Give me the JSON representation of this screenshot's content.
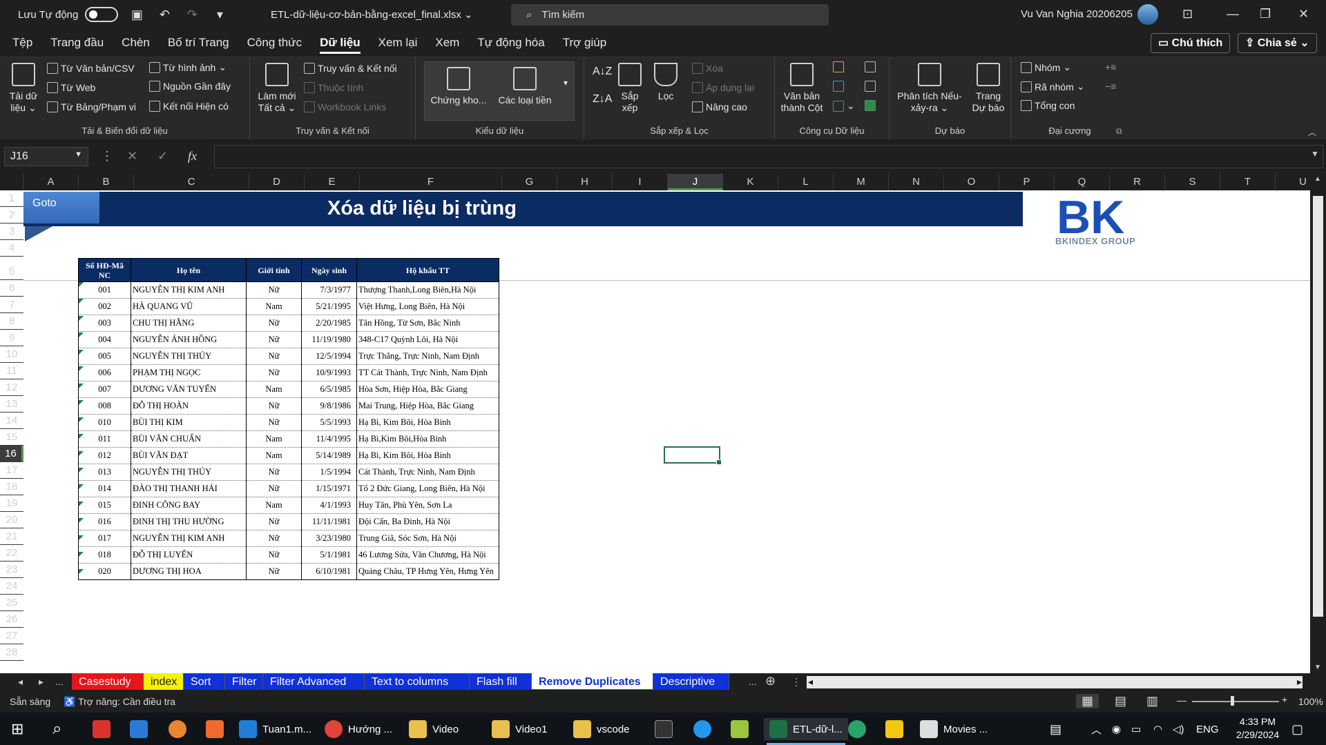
{
  "titlebar": {
    "autosave_label": "Lưu Tự động",
    "filename": "ETL-dữ-liệu-cơ-bản-bằng-excel_final.xlsx",
    "search_placeholder": "Tìm kiếm",
    "user": "Vu Van Nghia 20206205"
  },
  "menu": {
    "tabs": [
      "Tệp",
      "Trang đầu",
      "Chèn",
      "Bố trí Trang",
      "Công thức",
      "Dữ liệu",
      "Xem lại",
      "Xem",
      "Tự động hóa",
      "Trợ giúp"
    ],
    "active_tab": "Dữ liệu",
    "comment_btn": "Chú thích",
    "share_btn": "Chia sẻ"
  },
  "ribbon": {
    "g1": {
      "label": "Tải & Biến đổi dữ liệu",
      "big_line1": "Tải dữ",
      "big_line2": "liệu",
      "items": [
        "Từ Văn bản/CSV",
        "Từ Web",
        "Từ Bảng/Phạm vi",
        "Từ hình ảnh",
        "Nguồn Gần đây",
        "Kết nối Hiện có"
      ]
    },
    "g2": {
      "label": "Truy vấn & Kết nối",
      "big_line1": "Làm mới",
      "big_line2": "Tất cả",
      "items": [
        "Truy vấn & Kết nối",
        "Thuộc tính",
        "Workbook Links"
      ]
    },
    "g3": {
      "label": "Kiểu dữ liệu",
      "item1": "Chứng kho...",
      "item2": "Các loại tiền"
    },
    "g4": {
      "label": "Sắp xếp & Lọc",
      "sort_line1": "Sắp",
      "sort_line2": "xếp",
      "filter": "Lọc",
      "items": [
        "Xóa",
        "Áp dụng lại",
        "Nâng cao"
      ]
    },
    "g5": {
      "label": "Công cụ Dữ liệu",
      "line1": "Văn bản",
      "line2": "thành Cột"
    },
    "g6": {
      "label": "Dự báo",
      "whatif_line1": "Phân tích Nếu-",
      "whatif_line2": "xảy-ra",
      "fc_line1": "Trang",
      "fc_line2": "Dự báo"
    },
    "g7": {
      "label": "Đại cương",
      "items": [
        "Nhóm",
        "Rã nhóm",
        "Tổng con"
      ]
    }
  },
  "formula": {
    "namebox": "J16",
    "fx": "fx",
    "value": ""
  },
  "columns": [
    "A",
    "B",
    "C",
    "D",
    "E",
    "F",
    "G",
    "H",
    "I",
    "J",
    "K",
    "L",
    "M",
    "N",
    "O",
    "P",
    "Q",
    "R",
    "S",
    "T",
    "U"
  ],
  "selected_column": "J",
  "rows": [
    "1",
    "2",
    "3",
    "4",
    "5",
    "6",
    "7",
    "8",
    "9",
    "10",
    "11",
    "12",
    "13",
    "14",
    "15",
    "16",
    "17",
    "18",
    "19",
    "20",
    "21",
    "22",
    "23",
    "24",
    "25",
    "26",
    "27",
    "28"
  ],
  "selected_row": "16",
  "sheet": {
    "goto_label": "Goto",
    "title": "Xóa dữ liệu bị trùng",
    "logo_text": "BKINDEX GROUP",
    "logo_mark": "BK"
  },
  "table": {
    "headers": [
      "Số HĐ-Mã NC",
      "Họ tên",
      "Giới tính",
      "Ngày sinh",
      "Hộ khẩu TT"
    ],
    "rows": [
      [
        "001",
        "NGUYỄN THỊ KIM ANH",
        "Nữ",
        "7/3/1977",
        "Thượng Thanh,Long Biên,Hà Nội"
      ],
      [
        "002",
        "HÀ QUANG VŨ",
        "Nam",
        "5/21/1995",
        "Việt Hưng, Long Biên, Hà Nội"
      ],
      [
        "003",
        "CHU THỊ HẰNG",
        "Nữ",
        "2/20/1985",
        "Tân Hồng, Từ Sơn, Bắc Ninh"
      ],
      [
        "004",
        "NGUYỄN ÁNH HỒNG",
        "Nữ",
        "11/19/1980",
        "348-C17 Quỳnh Lôi, Hà Nội"
      ],
      [
        "005",
        "NGUYỄN THỊ THÚY",
        "Nữ",
        "12/5/1994",
        "Trực Thắng, Trực Ninh, Nam Định"
      ],
      [
        "006",
        "PHẠM THỊ NGỌC",
        "Nữ",
        "10/9/1993",
        "TT Cát Thành, Trực Ninh, Nam Định"
      ],
      [
        "007",
        "DƯƠNG VĂN TUYẾN",
        "Nam",
        "6/5/1985",
        "Hòa Sơn, Hiệp Hòa, Bắc Giang"
      ],
      [
        "008",
        "ĐỖ THỊ HOÀN",
        "Nữ",
        "9/8/1986",
        "Mai Trung, Hiệp Hòa, Bắc Giang"
      ],
      [
        "010",
        "BÙI THỊ KIM",
        "Nữ",
        "5/5/1993",
        "Hạ Bì, Kim Bôi, Hòa Bình"
      ],
      [
        "011",
        "BÙI VĂN CHUẨN",
        "Nam",
        "11/4/1995",
        "Hạ Bì,Kim Bôi,Hòa Bình"
      ],
      [
        "012",
        "BÙI VĂN ĐẠT",
        "Nam",
        "5/14/1989",
        "Hạ Bì, Kim Bôi, Hòa Bình"
      ],
      [
        "013",
        "NGUYỄN THỊ THÚY",
        "Nữ",
        "1/5/1994",
        "Cát Thành, Trực Ninh, Nam Định"
      ],
      [
        "014",
        "ĐÀO THỊ THANH HẢI",
        "Nữ",
        "1/15/1971",
        "Tổ 2 Đức Giang, Long Biên, Hà Nội"
      ],
      [
        "015",
        "ĐINH CÔNG BAY",
        "Nam",
        "4/1/1993",
        "Huy Tân, Phù Yên, Sơn La"
      ],
      [
        "016",
        "ĐINH THỊ THU HƯỜNG",
        "Nữ",
        "11/11/1981",
        "Đội Cấn, Ba Đình, Hà Nội"
      ],
      [
        "017",
        "NGUYỄN THỊ KIM ANH",
        "Nữ",
        "3/23/1980",
        "Trung Giã, Sóc Sơn, Hà Nội"
      ],
      [
        "018",
        "ĐỖ THỊ LUYẾN",
        "Nữ",
        "5/1/1981",
        "46 Lương Sửa, Văn Chương, Hà Nội"
      ],
      [
        "020",
        "DƯƠNG THỊ HOA",
        "Nữ",
        "6/10/1981",
        "Quảng Châu, TP Hưng Yên, Hưng Yên"
      ]
    ]
  },
  "sheet_tabs": {
    "ellipsis": "...",
    "tabs": [
      {
        "label": "Casestudy",
        "bg": "#e8141b",
        "fg": "#ffffff"
      },
      {
        "label": "index",
        "bg": "#f3f00a",
        "fg": "#1f1f1f"
      },
      {
        "label": "Sort",
        "bg": "#1030d8",
        "fg": "#ffffff"
      },
      {
        "label": "Filter",
        "bg": "#1030d8",
        "fg": "#ffffff"
      },
      {
        "label": "Filter Advanced",
        "bg": "#1030d8",
        "fg": "#ffffff"
      },
      {
        "label": "Text to columns",
        "bg": "#1030d8",
        "fg": "#ffffff"
      },
      {
        "label": "Flash fill",
        "bg": "#1030d8",
        "fg": "#ffffff"
      },
      {
        "label": "Remove Duplicates",
        "bg": "#ffffff",
        "fg": "#1030d8"
      },
      {
        "label": "Descriptive s",
        "bg": "#1030d8",
        "fg": "#ffffff"
      }
    ],
    "more": "..."
  },
  "status": {
    "ready": "Sẵn sàng",
    "accessibility": "Trợ năng: Cần điều tra",
    "zoom": "100%"
  },
  "taskbar": {
    "items": [
      "Tuan1.m...",
      "Hướng ...",
      "Video",
      "Video1",
      "vscode",
      "ETL-dữ-l...",
      "Movies ..."
    ],
    "lang": "ENG",
    "time": "4:33 PM",
    "date": "2/29/2024"
  },
  "colors": {
    "banner": "#0b2b63",
    "excel_green": "#217346",
    "goto": "#3d72c4"
  }
}
